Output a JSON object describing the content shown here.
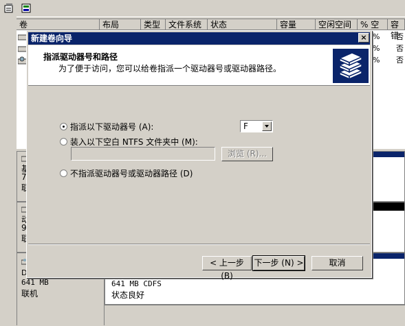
{
  "toolbar": {
    "btn1_icon": "properties-icon",
    "btn2_icon": "help-icon"
  },
  "columns": [
    "卷",
    "布局",
    "类型",
    "文件系统",
    "状态",
    "容量",
    "空闲空间",
    "% 空闲",
    "容错"
  ],
  "rows": [
    {
      "pct_free": "%",
      "fault": "否"
    },
    {
      "pct_free": "%",
      "fault": "否"
    },
    {
      "pct_free": "%",
      "fault": "否"
    }
  ],
  "disks": [
    {
      "line1": "基",
      "line2": "7",
      "line3": "联"
    },
    {
      "line1": "动",
      "line2": "9",
      "line3": "联"
    },
    {
      "line1": "D",
      "size": "641 MB",
      "status": "联机"
    }
  ],
  "cdrom_partition": {
    "size_fs": "641 MB CDFS",
    "status": "状态良好"
  },
  "dialog": {
    "title": "新建卷向导",
    "close": "×",
    "header_title": "指派驱动器号和路径",
    "header_desc": "为了便于访问，您可以给卷指派一个驱动器号或驱动器路径。",
    "options": {
      "assign_letter": "指派以下驱动器号 (A):",
      "mount_folder": "装入以下空白 NTFS 文件夹中 (M):",
      "no_assign": "不指派驱动器号或驱动器路径 (D)"
    },
    "selected_option": "assign_letter",
    "drive_letter": "F",
    "browse": "浏览 (R)...",
    "buttons": {
      "back": "< 上一步 (B)",
      "next": "下一步 (N) >",
      "cancel": "取消"
    }
  }
}
